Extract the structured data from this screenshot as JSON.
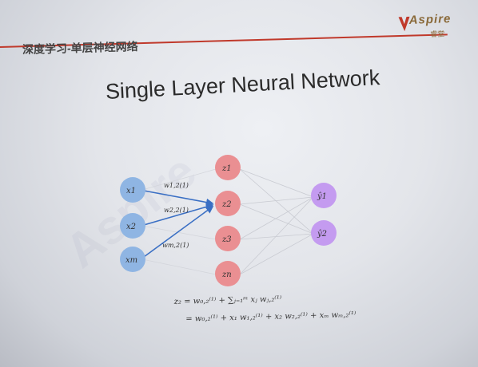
{
  "header": {
    "title": "深度学习-单层神经网络",
    "accent_color": "#c0392b"
  },
  "logo": {
    "name": "Aspire",
    "sub": "睿堂",
    "icon": "aspire-logo-icon"
  },
  "slide": {
    "title": "Single Layer Neural Network"
  },
  "network": {
    "inputs": [
      "x1",
      "x2",
      "xm"
    ],
    "hidden": [
      "z1",
      "z2",
      "z3",
      "zn"
    ],
    "outputs": [
      "ŷ1",
      "ŷ2"
    ],
    "weights": [
      "w1,2(1)",
      "w2,2(1)",
      "wm,2(1)"
    ],
    "colors": {
      "input": "#8fb5e3",
      "hidden": "#ea8f92",
      "output": "#c49bf0",
      "edge": "#3a6fc4"
    }
  },
  "formula": {
    "line1": "z₂ = w₀,₂⁽¹⁾ + ∑ⱼ₌₁ᵐ xⱼ wⱼ,₂⁽¹⁾",
    "line2": "= w₀,₂⁽¹⁾ + x₁ w₁,₂⁽¹⁾ + x₂ w₂,₂⁽¹⁾ + xₘ wₘ,₂⁽¹⁾"
  }
}
